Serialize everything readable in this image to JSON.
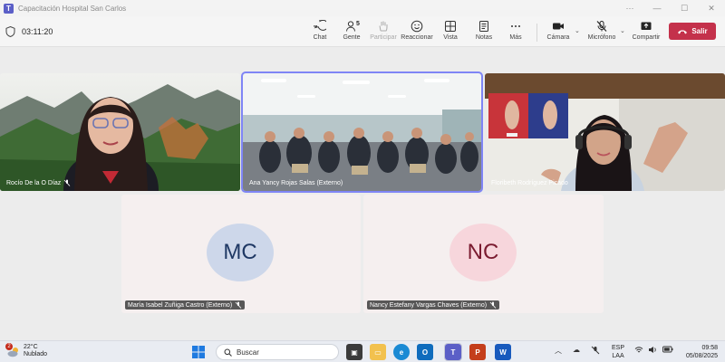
{
  "window": {
    "title": "Capacitación Hospital San Carlos",
    "logo_letter": "T"
  },
  "toolbar": {
    "timer": "03:11:20",
    "chat": "Chat",
    "people": "Gente",
    "people_count": "5",
    "raise": "Participar",
    "react": "Reaccionar",
    "view": "Vista",
    "notes": "Notas",
    "more": "Más",
    "camera": "Cámara",
    "mic": "Micrófono",
    "share": "Compartir",
    "leave": "Salir"
  },
  "participants": [
    {
      "name": "Rocío De la O Díaz",
      "video": true
    },
    {
      "name": "Ana Yancy Rojas Salas (Externo)",
      "video": true,
      "active_speaker": true
    },
    {
      "name": "Floribeth Rodríguez Picado",
      "video": true
    },
    {
      "name": "María Isabel Zuñiga Castro (Externo)",
      "video": false,
      "initials": "MC",
      "muted": true
    },
    {
      "name": "Nancy Estefany Vargas Chaves (Externo)",
      "video": false,
      "initials": "NC",
      "muted": true
    }
  ],
  "taskbar": {
    "weather_temp": "22°C",
    "weather_desc": "Nublado",
    "notification_count": "2",
    "search_placeholder": "Buscar",
    "lang_top": "ESP",
    "lang_bottom": "LAA",
    "time": "09:58",
    "date": "05/08/2025"
  },
  "colors": {
    "leave": "#c4314b",
    "accent": "#5b5fc7",
    "active_outline": "#7f85f5",
    "mc_avatar": "#cdd7ea",
    "nc_avatar": "#f7d6dc"
  }
}
